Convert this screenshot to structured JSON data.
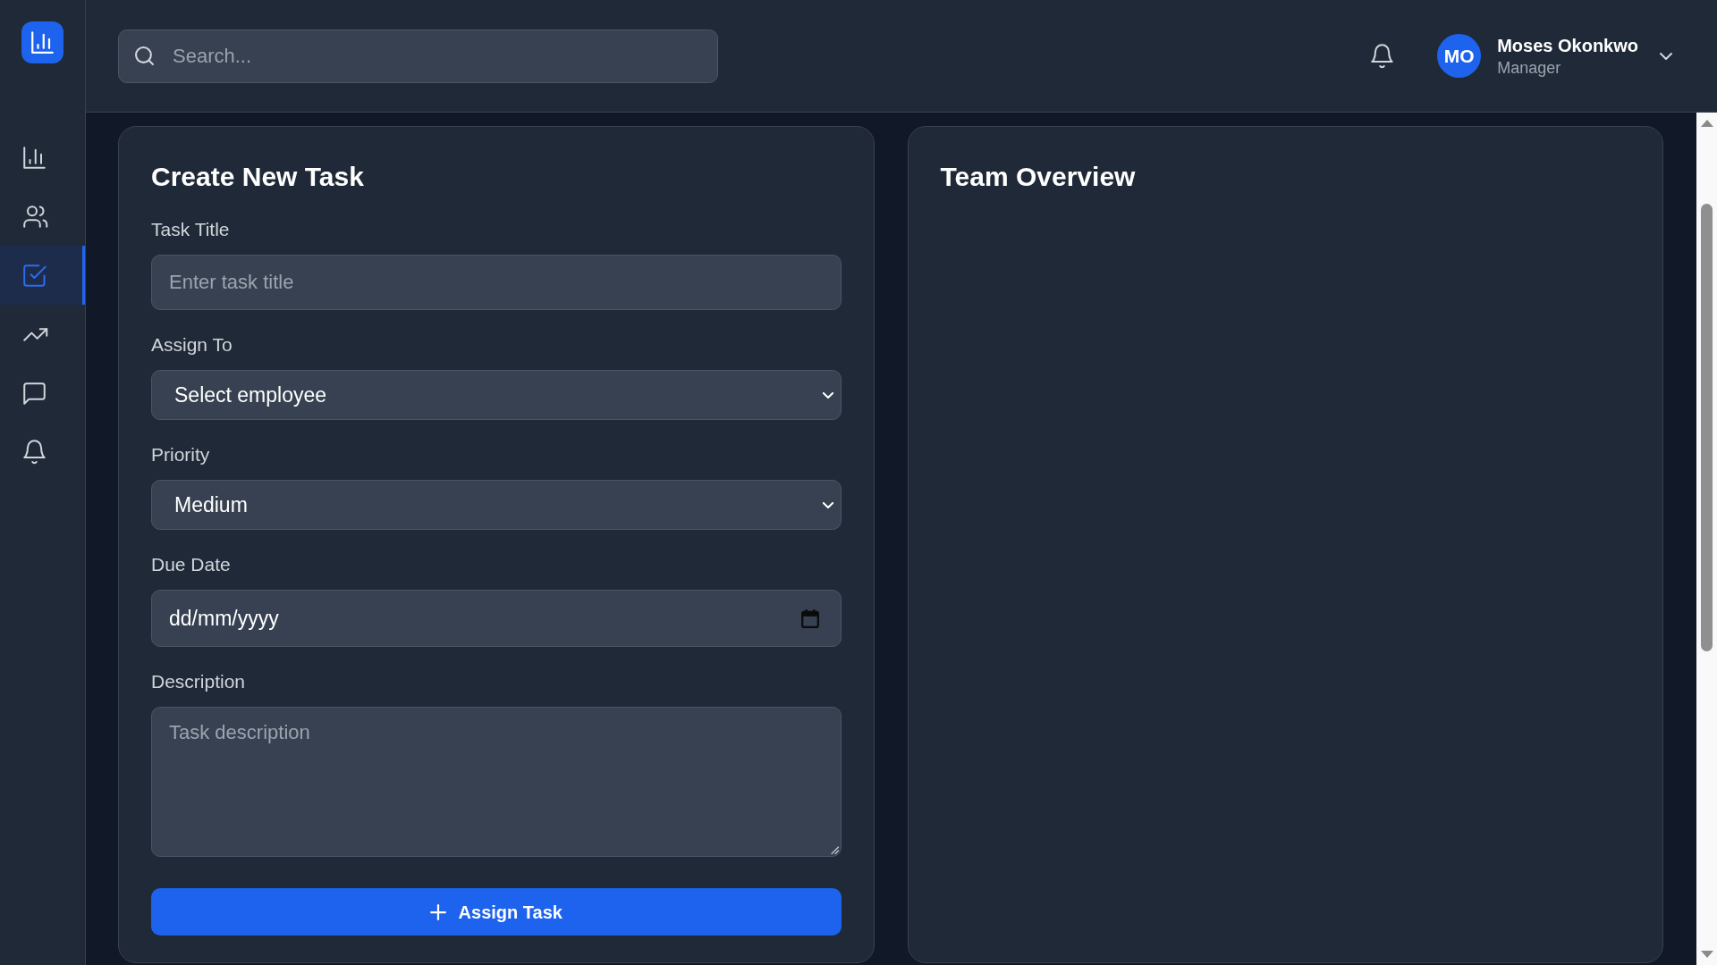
{
  "sidebar": {
    "nav_items": [
      {
        "selected": false
      },
      {
        "selected": false
      },
      {
        "selected": true
      },
      {
        "selected": false
      },
      {
        "selected": false
      },
      {
        "selected": false
      }
    ]
  },
  "header": {
    "search": {
      "placeholder": "Search..."
    },
    "user": {
      "initials": "MO",
      "name": "Moses Okonkwo",
      "role": "Manager"
    }
  },
  "create_task": {
    "title": "Create New Task",
    "fields": [
      {
        "kind": "text",
        "label": "Task Title",
        "placeholder": "Enter task title"
      },
      {
        "kind": "select",
        "label": "Assign To",
        "value": "Select employee"
      },
      {
        "kind": "select",
        "label": "Priority",
        "value": "Medium"
      },
      {
        "kind": "date",
        "label": "Due Date",
        "placeholder": "dd/mm/yyyy"
      },
      {
        "kind": "textarea",
        "label": "Description",
        "placeholder": "Task description"
      }
    ],
    "submit": {
      "label": "Assign Task"
    }
  },
  "team_overview": {
    "title": "Team Overview"
  }
}
